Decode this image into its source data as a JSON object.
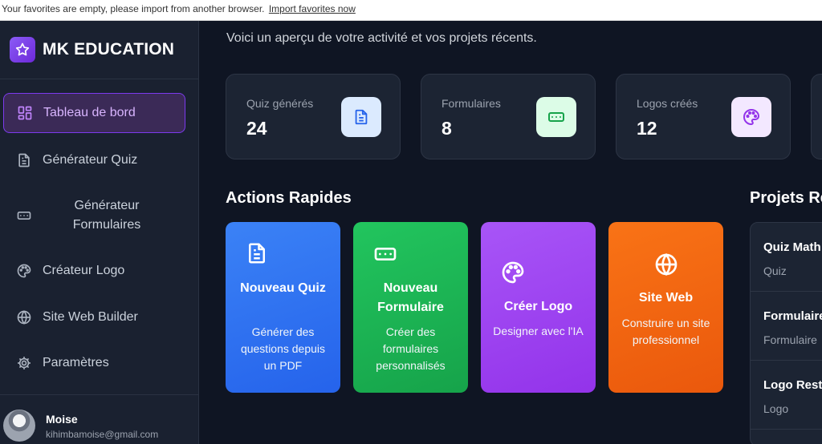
{
  "favorites_bar": {
    "message": "Your favorites are empty, please import from another browser.",
    "link": "Import favorites now"
  },
  "brand": {
    "name": "MK EDUCATION",
    "icon": "star-icon"
  },
  "sidebar": {
    "items": [
      {
        "label": "Tableau de bord",
        "icon": "dashboard-grid-icon",
        "active": true
      },
      {
        "label": "Générateur Quiz",
        "icon": "document-icon"
      },
      {
        "label": "Générateur Formulaires",
        "icon": "form-input-icon"
      },
      {
        "label": "Créateur Logo",
        "icon": "palette-icon"
      },
      {
        "label": "Site Web Builder",
        "icon": "globe-icon"
      },
      {
        "label": "Paramètres",
        "icon": "gear-icon"
      }
    ]
  },
  "user": {
    "name": "Moise",
    "email": "kihimbamoise@gmail.com"
  },
  "main": {
    "subtitle": "Voici un aperçu de votre activité et vos projets récents.",
    "stats": [
      {
        "label": "Quiz générés",
        "value": "24",
        "icon": "document-icon",
        "color": "#3b82f6"
      },
      {
        "label": "Formulaires",
        "value": "8",
        "icon": "form-input-icon",
        "color": "#16a34a"
      },
      {
        "label": "Logos créés",
        "value": "12",
        "icon": "palette-icon",
        "color": "#a855f7"
      }
    ],
    "quick_actions_title": "Actions Rapides",
    "quick_actions": [
      {
        "title": "Nouveau Quiz",
        "description": "Générer des questions depuis un PDF",
        "icon": "document-icon",
        "color": "#3b82f6"
      },
      {
        "title": "Nouveau Formulaire",
        "description": "Créer des formulaires personnalisés",
        "icon": "form-input-icon",
        "color": "#22c55e"
      },
      {
        "title": "Créer Logo",
        "description": "Designer avec l'IA",
        "icon": "palette-icon",
        "color": "#a855f7"
      },
      {
        "title": "Site Web",
        "description": "Construire un site professionnel",
        "icon": "globe-icon",
        "color": "#f97316"
      }
    ],
    "recent_title": "Projets Ré",
    "recent": [
      {
        "name": "Quiz Math",
        "type": "Quiz"
      },
      {
        "name": "Formulaire",
        "type": "Formulaire"
      },
      {
        "name": "Logo Rest",
        "type": "Logo"
      }
    ]
  }
}
